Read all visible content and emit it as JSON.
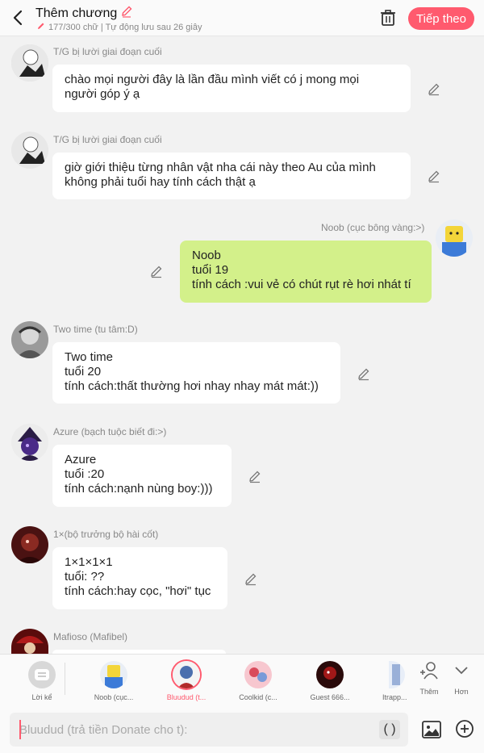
{
  "header": {
    "title": "Thêm chương",
    "subtitle": "177/300 chữ | Tự động lưu sau 26 giây",
    "next_label": "Tiếp theo"
  },
  "messages": [
    {
      "name": "T/G bị lười giai đoạn cuối",
      "lines": [
        "chào mọi người đây là lần đầu mình viết có j mong mọi",
        "người góp ý ạ"
      ]
    },
    {
      "name": "T/G bị lười giai đoạn cuối",
      "lines": [
        "giờ giới thiệu từng nhân vật nha cái này theo Au của mình",
        "không phải tuổi hay tính cách thật ạ"
      ]
    },
    {
      "name": "Noob (cục bông vàng:>)",
      "lines": [
        "Noob",
        "tuổi 19",
        "tính cách :vui vẻ có chút rụt rè hơi nhát tí"
      ]
    },
    {
      "name": "Two time (tu tâm:D)",
      "lines": [
        "Two time",
        "tuổi 20",
        "tính cách:thất thường hơi nhay nhay mát mát:))"
      ]
    },
    {
      "name": "Azure (bạch tuộc biết đi:>)",
      "lines": [
        "Azure",
        "tuổi :20",
        "tính cách:nạnh nùng boy:)))"
      ]
    },
    {
      "name": "1×(bộ trưởng bộ hài cốt)",
      "lines": [
        "1×1×1×1",
        "tuổi: ??",
        "tính cách:hay cọc, \"hơi\" tục"
      ]
    },
    {
      "name": "Mafioso (Mafibel)",
      "lines": []
    }
  ],
  "characters": [
    {
      "label": "Lời kể"
    },
    {
      "label": "Noob (cục..."
    },
    {
      "label": "Bluudud (t..."
    },
    {
      "label": "Coolkid (c..."
    },
    {
      "label": "Guest 666..."
    },
    {
      "label": "Itrapp..."
    }
  ],
  "tools": {
    "add_label": "Thêm",
    "more_label": "Hơn"
  },
  "input": {
    "placeholder": "Bluudud (trả tiền Donate cho t):",
    "paren": "( )"
  },
  "colors": {
    "accent": "#ff5a6e",
    "my_bubble": "#d3f08a",
    "bubble": "#ffffff",
    "background": "#f2f2f2"
  }
}
